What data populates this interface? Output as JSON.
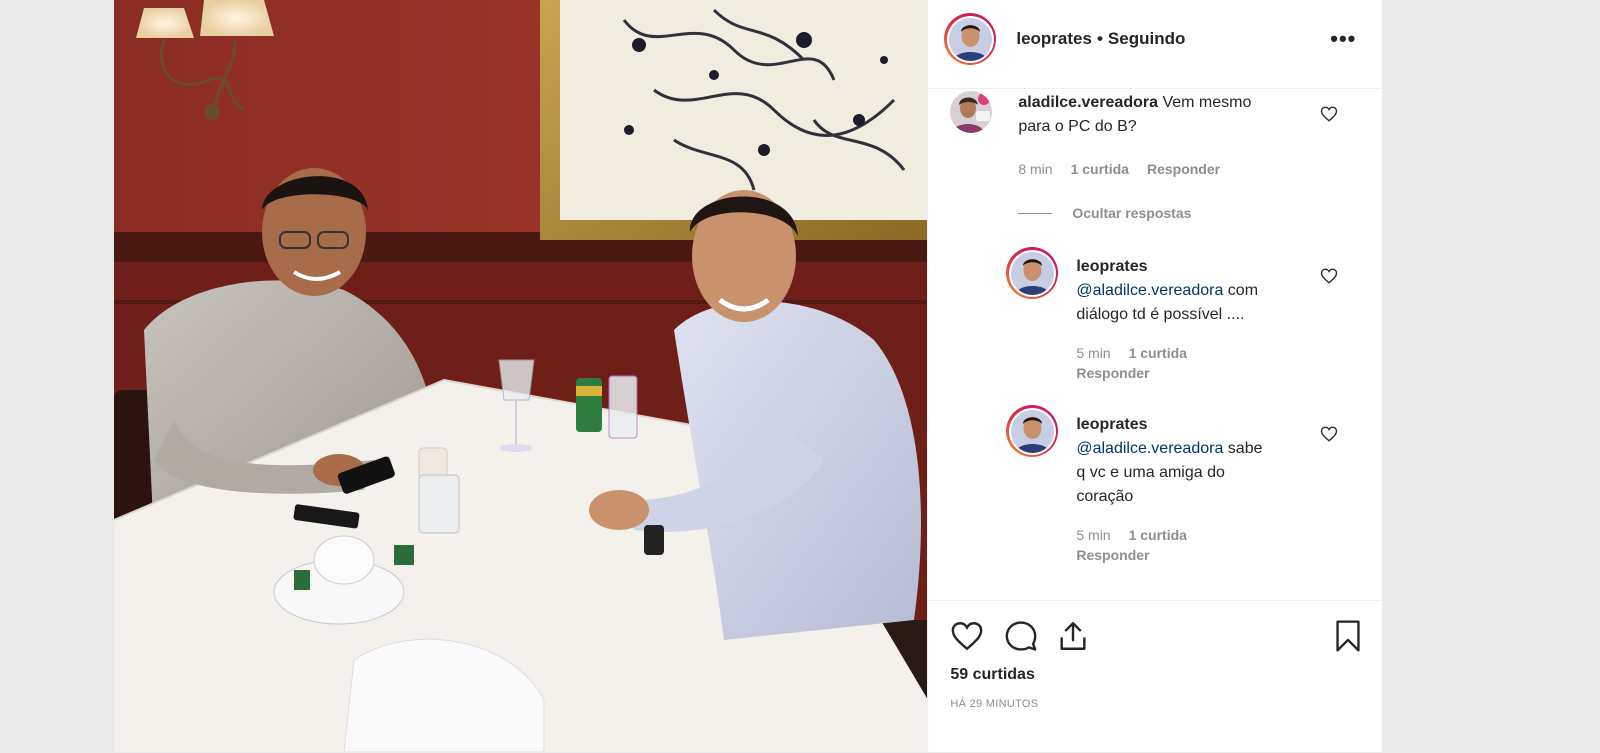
{
  "header": {
    "username": "leoprates",
    "separator": "•",
    "follow_status": "Seguindo",
    "more_label": "•••"
  },
  "comments": [
    {
      "username": "aladilce.vereadora",
      "text_line1": "Vem mesmo",
      "text_line2": "para o PC do B?",
      "age": "8 min",
      "likes": "1 curtida",
      "reply": "Responder"
    }
  ],
  "hide_replies": "Ocultar respostas",
  "replies": [
    {
      "username": "leoprates",
      "text_line1": "@aladilce.vereadora com",
      "text_line2": "diálogo td é possível ....",
      "text_line3": "",
      "age": "5 min",
      "likes": "1 curtida",
      "reply": "Responder"
    },
    {
      "username": "leoprates",
      "text_line1": "@aladilce.vereadora sabe",
      "text_line2": "q vc e uma amiga do",
      "text_line3": "coração",
      "age": "5 min",
      "likes": "1 curtida",
      "reply": "Responder"
    }
  ],
  "actions": {
    "like_icon": "heart-icon",
    "comment_icon": "comment-bubble-icon",
    "share_icon": "share-upload-icon",
    "save_icon": "bookmark-icon"
  },
  "likes_count": "59 curtidas",
  "posted_ago": "HÁ 29 MINUTOS",
  "colors": {
    "text": "#262626",
    "muted": "#8e8e8e",
    "border": "#efefef",
    "mention": "#003569"
  }
}
